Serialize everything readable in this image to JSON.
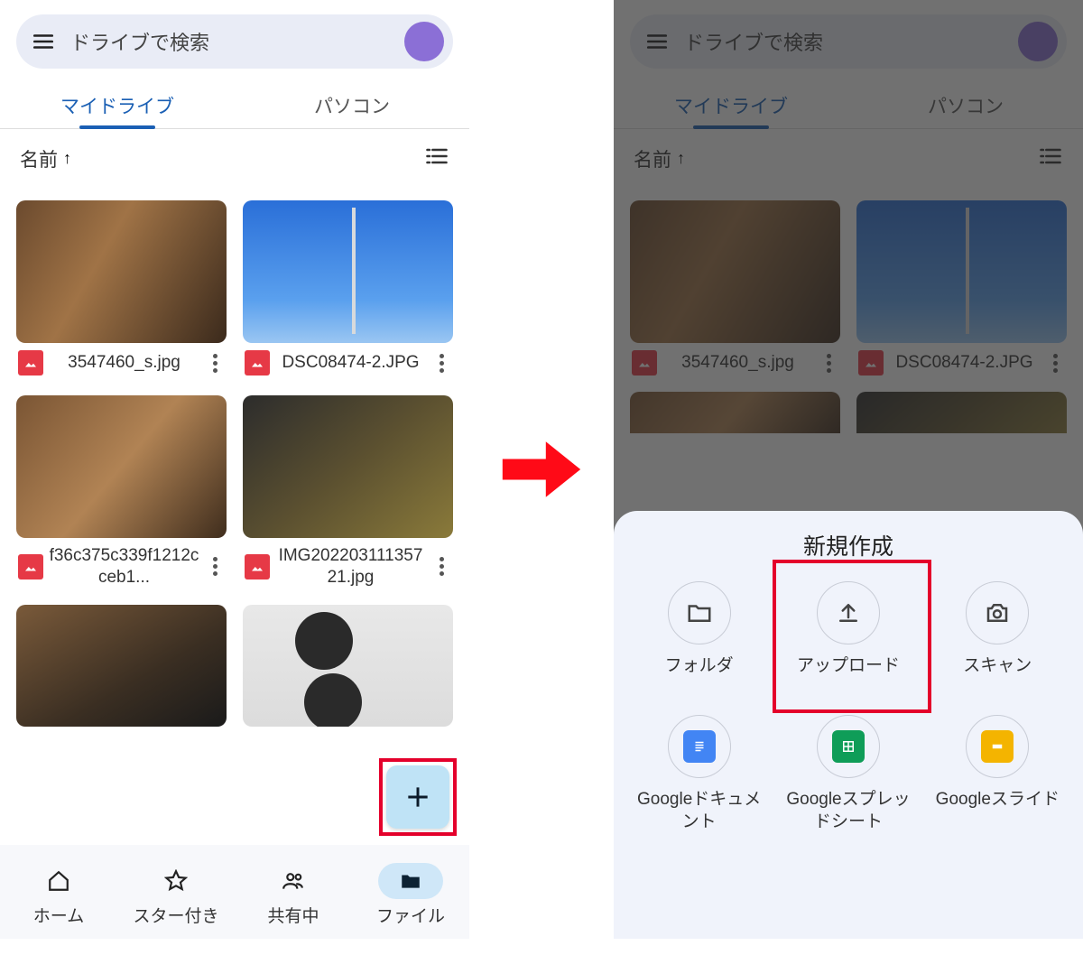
{
  "search_placeholder": "ドライブで検索",
  "tabs": {
    "mydrive": "マイドライブ",
    "pc": "パソコン"
  },
  "sort": {
    "label": "名前",
    "dir": "↑"
  },
  "files": [
    {
      "name": "3547460_s.jpg"
    },
    {
      "name": "DSC08474-2.JPG"
    },
    {
      "name": "f36c375c339f1212cceb1..."
    },
    {
      "name": "IMG20220311135721.jpg"
    }
  ],
  "nav": {
    "home": "ホーム",
    "star": "スター付き",
    "shared": "共有中",
    "files": "ファイル"
  },
  "sheet": {
    "title": "新規作成",
    "folder": "フォルダ",
    "upload": "アップロード",
    "scan": "スキャン",
    "docs": "Googleドキュメント",
    "sheets": "Googleスプレッドシート",
    "slides": "Googleスライド"
  }
}
